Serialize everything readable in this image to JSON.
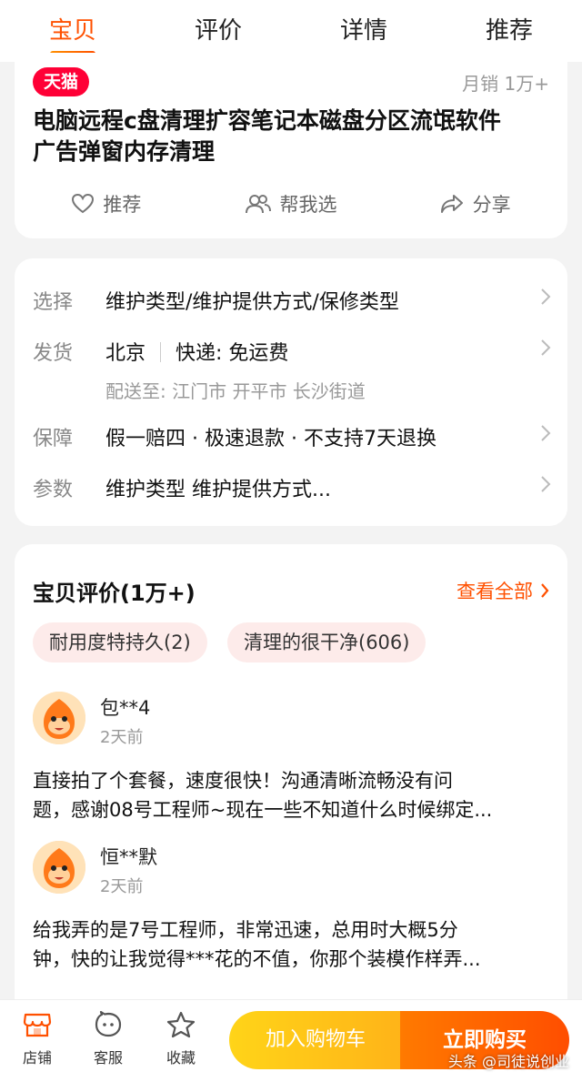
{
  "tabs": [
    {
      "label": "宝贝",
      "active": true
    },
    {
      "label": "评价",
      "active": false
    },
    {
      "label": "详情",
      "active": false
    },
    {
      "label": "推荐",
      "active": false
    }
  ],
  "product": {
    "badge": "天猫",
    "sales": "月销 1万+",
    "title_line1": "电脑远程c盘清理扩容笔记本磁盘分区流氓软件",
    "title_line2": "广告弹窗内存清理",
    "actions": {
      "recommend": "推荐",
      "help_choose": "帮我选",
      "share": "分享"
    }
  },
  "info": {
    "select": {
      "label": "选择",
      "value": "维护类型/维护提供方式/保修类型"
    },
    "ship": {
      "label": "发货",
      "city": "北京",
      "express": "快递: 免运费",
      "deliver_to": "配送至: 江门市 开平市 长沙街道"
    },
    "guarantee": {
      "label": "保障",
      "value": "假一赔四 · 极速退款 · 不支持7天退换"
    },
    "params": {
      "label": "参数",
      "value": "维护类型 维护提供方式..."
    }
  },
  "reviews": {
    "header": "宝贝评价(1万+)",
    "see_all": "查看全部",
    "tags": [
      "耐用度特持久(2)",
      "清理的很干净(606)"
    ],
    "items": [
      {
        "user": "包**4",
        "time": "2天前",
        "line1": "直接拍了个套餐，速度很快！沟通清晰流畅没有问",
        "line2": "题，感谢08号工程师~现在一些不知道什么时候绑定..."
      },
      {
        "user": "恒**默",
        "time": "2天前",
        "line1": "给我弄的是7号工程师，非常迅速，总用时大概5分",
        "line2": "钟，快的让我觉得***花的不值，你那个装模作样弄..."
      }
    ]
  },
  "bottom": {
    "shop": "店铺",
    "service": "客服",
    "favorite": "收藏",
    "add_cart": "加入购物车",
    "buy_now": "立即购买",
    "watermark": "头条 @司徒说创业"
  },
  "colors": {
    "accent": "#ff5000",
    "tmall": "#ff0036",
    "cart": "#ffc000",
    "buy": "#ff5a00"
  }
}
